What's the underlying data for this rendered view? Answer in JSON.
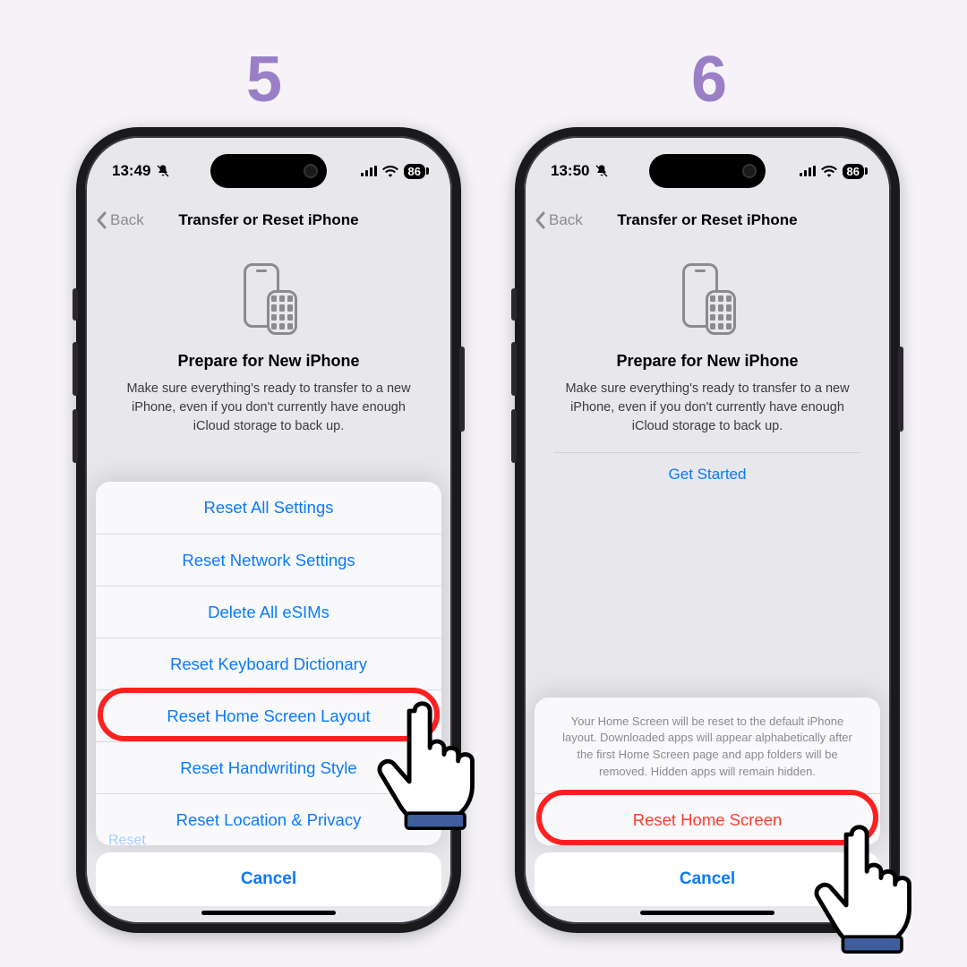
{
  "steps": {
    "five": "5",
    "six": "6"
  },
  "status": {
    "time5": "13:49",
    "time6": "13:50",
    "battery": "86"
  },
  "nav": {
    "back": "Back",
    "title": "Transfer or Reset iPhone"
  },
  "prepare": {
    "heading": "Prepare for New iPhone",
    "body": "Make sure everything's ready to transfer to a new iPhone, even if you don't currently have enough iCloud storage to back up.",
    "get_started": "Get Started"
  },
  "sheet5": {
    "opt1": "Reset All Settings",
    "opt2": "Reset Network Settings",
    "opt3": "Delete All eSIMs",
    "opt4": "Reset Keyboard Dictionary",
    "opt5": "Reset Home Screen Layout",
    "opt6": "Reset Handwriting Style",
    "opt7": "Reset Location & Privacy"
  },
  "sheet6": {
    "desc": "Your Home Screen will be reset to the default iPhone layout. Downloaded apps will appear alphabetically after the first Home Screen page and app folders will be removed. Hidden apps will remain hidden.",
    "confirm": "Reset Home Screen"
  },
  "cancel": "Cancel"
}
